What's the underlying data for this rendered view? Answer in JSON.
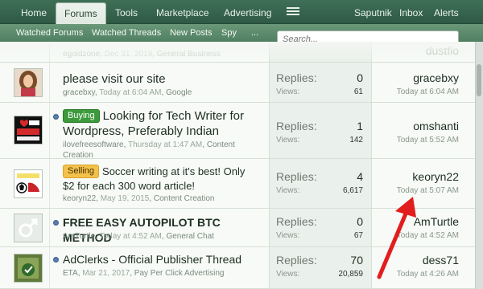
{
  "topnav": {
    "items": [
      "Home",
      "Forums",
      "Tools",
      "Marketplace",
      "Advertising",
      "Saputnik",
      "Inbox",
      "Alerts"
    ],
    "menu_icon": "hamburger-menu-icon"
  },
  "subnav": {
    "items": [
      "Watched Forums",
      "Watched Threads",
      "New Posts",
      "Spy",
      "..."
    ]
  },
  "search": {
    "placeholder": "Search..."
  },
  "threads": [
    {
      "title": "",
      "meta_user": "egoldzone",
      "meta_date": "Dec 31, 2019",
      "meta_forum": "General Business",
      "last_user": "dustfio"
    },
    {
      "title": "please visit our site",
      "meta_user": "gracebxy",
      "meta_date": "Today at 6:04 AM",
      "meta_forum": "Google",
      "replies_label": "Replies:",
      "replies": "0",
      "views_label": "Views:",
      "views": "61",
      "last_user": "gracebxy",
      "last_time": "Today at 6:04 AM"
    },
    {
      "prefix": "Buying",
      "title_line1": "Looking for Tech Writer for",
      "title_line2": "Wordpress, Preferably Indian",
      "meta_user": "ilovefreesoftware",
      "meta_date": "Thursday at 1:47 AM",
      "meta_forum_line1": "Content",
      "meta_forum_line2": "Creation",
      "replies_label": "Replies:",
      "replies": "1",
      "views_label": "Views:",
      "views": "142",
      "last_user": "omshanti",
      "last_time": "Today at 5:52 AM"
    },
    {
      "prefix": "Selling",
      "title_line1": "Soccer writing at it's best! Only",
      "title_line2": "$2 for each 300 word article!",
      "meta_user": "keoryn22",
      "meta_date": "May 19, 2015",
      "meta_forum": "Content Creation",
      "replies_label": "Replies:",
      "replies": "4",
      "views_label": "Views:",
      "views": "6,617",
      "last_user": "keoryn22",
      "last_time": "Today at 5:07 AM"
    },
    {
      "title": "FREE EASY AUTOPILOT BTC METHOD",
      "meta_user": "AmTurtle",
      "meta_date": "Today at 4:52 AM",
      "meta_forum": "General Chat",
      "replies_label": "Replies:",
      "replies": "0",
      "views_label": "Views:",
      "views": "67",
      "last_user": "AmTurtle",
      "last_time": "Today at 4:52 AM"
    },
    {
      "title": "AdClerks - Official Publisher Thread",
      "meta_user": "ETA",
      "meta_date": "Mar 21, 2017",
      "meta_forum": "Pay Per Click Advertising",
      "replies_label": "Replies:",
      "replies": "70",
      "views_label": "Views:",
      "views": "20,859",
      "last_user": "dess71",
      "last_time": "Today at 4:26 AM"
    }
  ],
  "colors": {
    "nav": "#2f5a45",
    "subnav": "#5a8a6a",
    "buying": "#3c9a3c",
    "selling": "#f4c24a",
    "arrow": "#e21d1d"
  }
}
